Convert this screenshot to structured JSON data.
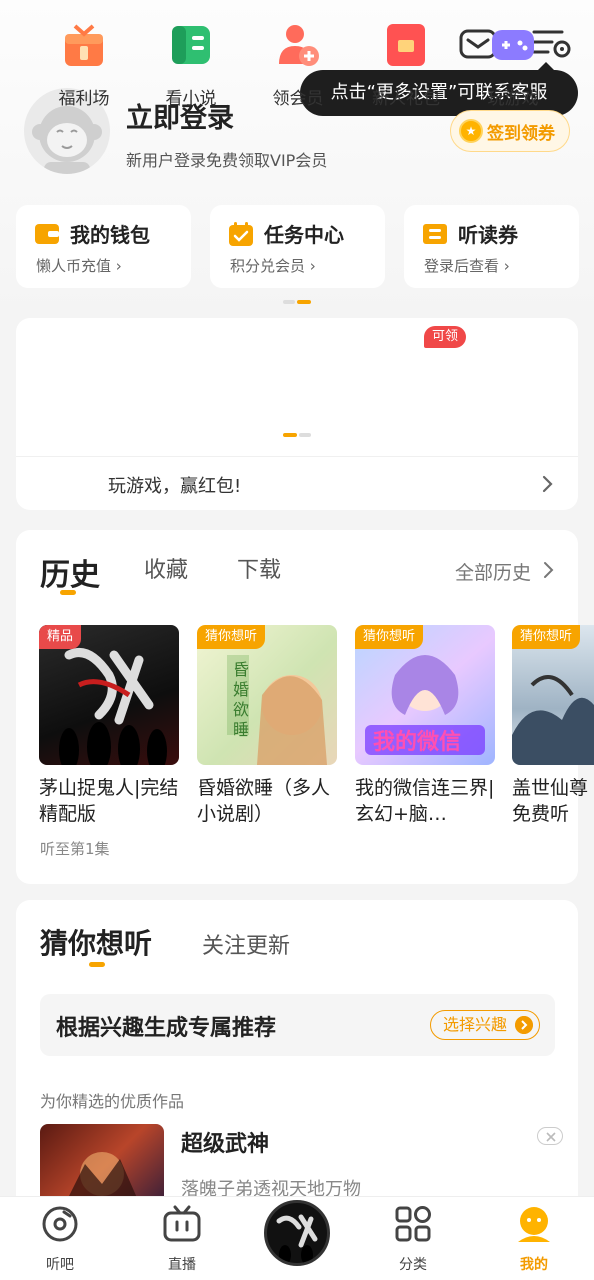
{
  "header": {
    "tooltip": "点击“更多设置”可联系客服",
    "login_title": "立即登录",
    "login_subtitle": "新用户登录免费领取VIP会员",
    "signin_button": "签到领券"
  },
  "quick_cards": [
    {
      "title": "我的钱包",
      "subtitle": "懒人币充值 ›",
      "icon": "wallet-icon"
    },
    {
      "title": "任务中心",
      "subtitle": "积分兑会员 ›",
      "icon": "task-calendar-icon"
    },
    {
      "title": "听读券",
      "subtitle": "登录后查看 ›",
      "icon": "ticket-icon"
    }
  ],
  "features": {
    "items": [
      {
        "label": "福利场",
        "icon": "gift-box-icon"
      },
      {
        "label": "看小说",
        "icon": "book-icon"
      },
      {
        "label": "领会员",
        "icon": "vip-user-icon"
      },
      {
        "label": "新人礼包",
        "icon": "red-packet-icon"
      },
      {
        "label": "玩游戏",
        "icon": "gamepad-icon"
      }
    ],
    "badge": "可领",
    "promo": "玩游戏，赢红包!"
  },
  "history": {
    "tabs": [
      "历史",
      "收藏",
      "下载"
    ],
    "all_link": "全部历史",
    "books": [
      {
        "tag": "精品",
        "title": "茅山捉鬼人|完结精配版",
        "progress": "听至第1集"
      },
      {
        "tag": "猜你想听",
        "title": "昏婚欲睡（多人小说剧）"
      },
      {
        "tag": "猜你想听",
        "title": "我的微信连三界|玄幻+脑…"
      },
      {
        "tag": "猜你想听",
        "title": "盖世仙尊免费听"
      }
    ]
  },
  "guess": {
    "tabs": [
      "猜你想听",
      "关注更新"
    ],
    "interest_text": "根据兴趣生成专属推荐",
    "interest_button": "选择兴趣",
    "picked_label": "为你精选的优质作品",
    "rec_title": "超级武神",
    "rec_subtitle": "落魄子弟透视天地万物"
  },
  "bottom_nav": [
    {
      "label": "听吧",
      "icon": "disc-icon"
    },
    {
      "label": "直播",
      "icon": "tv-icon"
    },
    {
      "label": "分类",
      "icon": "grid-icon"
    },
    {
      "label": "我的",
      "icon": "profile-icon"
    }
  ],
  "colors": {
    "accent": "#f7a400",
    "badge_red": "#f04848"
  }
}
